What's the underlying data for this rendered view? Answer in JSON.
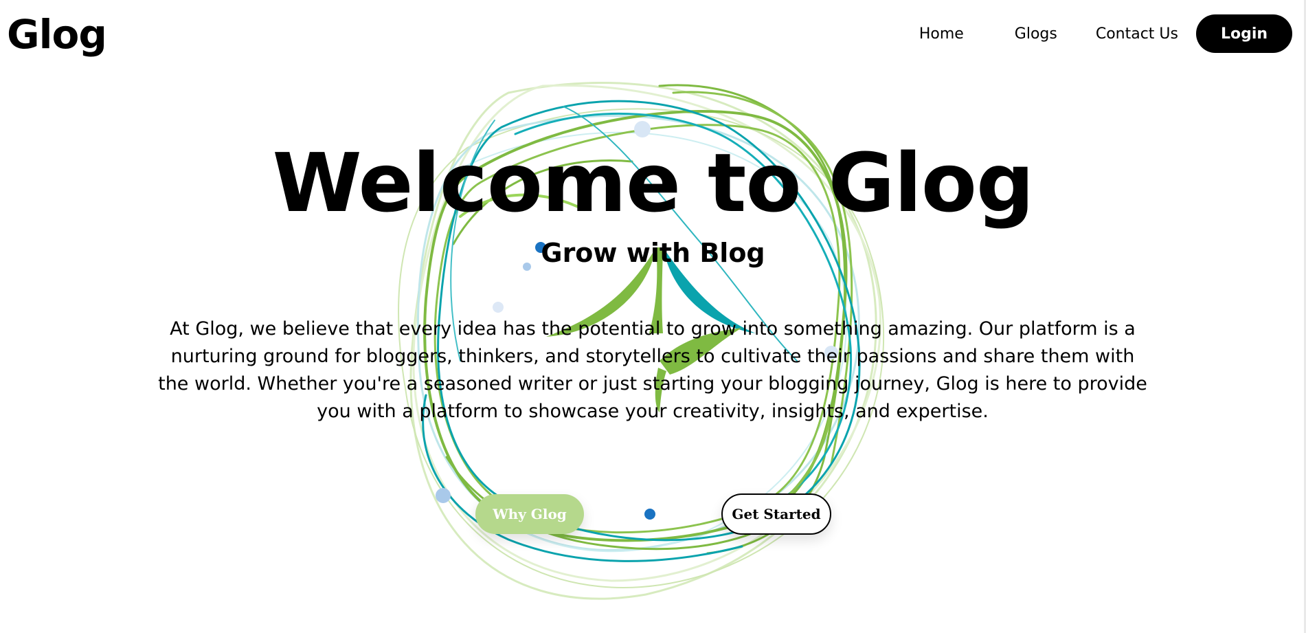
{
  "header": {
    "logo": "Glog",
    "nav": {
      "home": "Home",
      "glogs": "Glogs",
      "contact": "Contact Us",
      "login": "Login"
    }
  },
  "hero": {
    "title": "Welcome to Glog",
    "subtitle": "Grow with Blog",
    "description": "At Glog, we believe that every idea has the potential to grow into something amazing. Our platform is a nurturing ground for bloggers, thinkers, and storytellers to cultivate their passions and share them with the world. Whether you're a seasoned writer or just starting your blogging journey, Glog is here to provide you with a platform to showcase your creativity, insights, and expertise.",
    "buttons": {
      "why": "Why Glog",
      "start": "Get Started"
    }
  },
  "colors": {
    "accent_green": "#7fba42",
    "accent_teal": "#0aa3ad",
    "button_green": "#b5d88c",
    "dot_blue": "#1a73c2"
  },
  "icons": {
    "hero_art": "leaf-sprout-swirl-icon"
  }
}
